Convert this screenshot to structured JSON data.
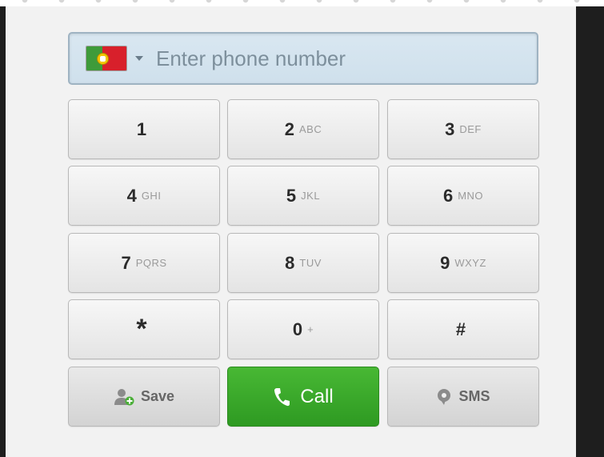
{
  "phone_field": {
    "placeholder": "Enter phone number",
    "country_flag": "portugal-flag",
    "flag_colors": {
      "green": "#3e9b3a",
      "red": "#d8202b",
      "emblem": "#f3c400"
    }
  },
  "keypad": {
    "keys": [
      {
        "digit": "1",
        "letters": ""
      },
      {
        "digit": "2",
        "letters": "ABC"
      },
      {
        "digit": "3",
        "letters": "DEF"
      },
      {
        "digit": "4",
        "letters": "GHI"
      },
      {
        "digit": "5",
        "letters": "JKL"
      },
      {
        "digit": "6",
        "letters": "MNO"
      },
      {
        "digit": "7",
        "letters": "PQRS"
      },
      {
        "digit": "8",
        "letters": "TUV"
      },
      {
        "digit": "9",
        "letters": "WXYZ"
      },
      {
        "digit": "*",
        "letters": ""
      },
      {
        "digit": "0",
        "letters": "+"
      },
      {
        "digit": "#",
        "letters": ""
      }
    ]
  },
  "actions": {
    "save_label": "Save",
    "save_icon": "add-contact-icon",
    "call_label": "Call",
    "call_icon": "phone-icon",
    "call_color": "#3cab2c",
    "sms_label": "SMS",
    "sms_icon": "chat-bubble-icon"
  }
}
